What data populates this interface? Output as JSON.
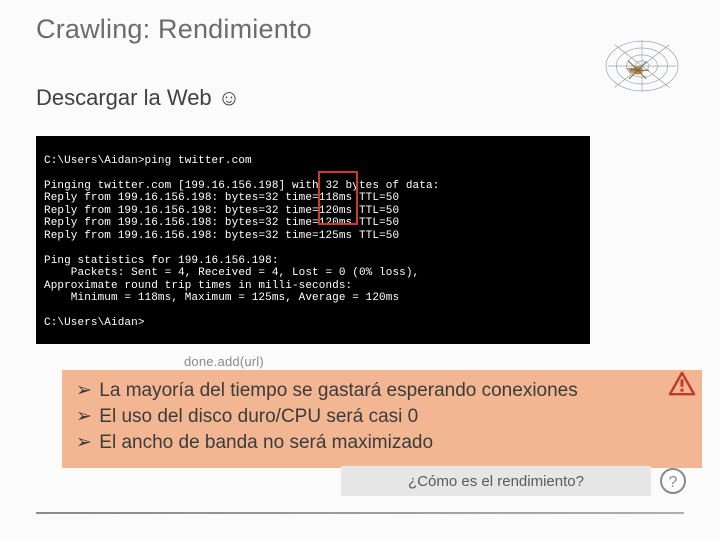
{
  "title": "Crawling: Rendimiento",
  "subtitle": "Descargar la Web",
  "smiley": "☺",
  "terminal": {
    "lines": [
      "C:\\Users\\Aidan>ping twitter.com",
      "",
      "Pinging twitter.com [199.16.156.198] with 32 bytes of data:",
      "Reply from 199.16.156.198: bytes=32 time=118ms TTL=50",
      "Reply from 199.16.156.198: bytes=32 time=120ms TTL=50",
      "Reply from 199.16.156.198: bytes=32 time=120ms TTL=50",
      "Reply from 199.16.156.198: bytes=32 time=125ms TTL=50",
      "",
      "Ping statistics for 199.16.156.198:",
      "    Packets: Sent = 4, Received = 4, Lost = 0 (0% loss),",
      "Approximate round trip times in milli-seconds:",
      "    Minimum = 118ms, Maximum = 125ms, Average = 120ms",
      "",
      "C:\\Users\\Aidan>"
    ],
    "highlight_times": [
      "118ms",
      "120ms",
      "120ms",
      "125ms"
    ]
  },
  "ghost_code": "done.add(url)",
  "callout": {
    "chevron": "➢",
    "items": [
      "La mayoría del tiempo se gastará esperando conexiones",
      "El uso del disco duro/CPU será casi 0",
      "El ancho de banda no será maximizado"
    ]
  },
  "warning_glyph": "⚠",
  "footer_question": "¿Cómo es el rendimiento?",
  "qmark_glyph": "?"
}
